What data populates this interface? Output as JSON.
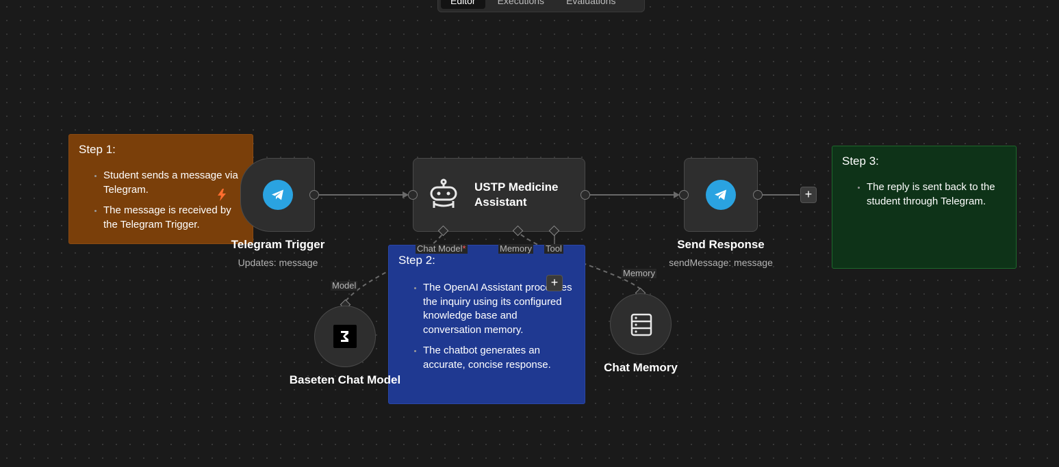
{
  "tabs": [
    {
      "label": "Editor",
      "active": true
    },
    {
      "label": "Executions",
      "active": false
    },
    {
      "label": "Evaluations",
      "active": false
    }
  ],
  "sticky_notes": {
    "step1": {
      "title": "Step 1:",
      "items": [
        "Student sends a message via Telegram.",
        "The message is received by the Telegram Trigger."
      ],
      "color": "#7a3f0a"
    },
    "step2": {
      "title": "Step 2:",
      "items": [
        "The OpenAI Assistant processes the inquiry using its configured knowledge base and conversation memory.",
        "The chatbot generates an accurate, concise response."
      ],
      "color": "#1f3991"
    },
    "step3": {
      "title": "Step 3:",
      "items": [
        "The reply is sent back to the student through Telegram."
      ],
      "color": "#0e3318"
    }
  },
  "nodes": {
    "telegram_trigger": {
      "label": "Telegram Trigger",
      "subtitle": "Updates: message",
      "icon": "telegram-icon"
    },
    "agent": {
      "label": "USTP Medicine Assistant",
      "icon": "robot-icon",
      "ports": {
        "chat_model": "Chat Model",
        "required_marker": "*",
        "memory": "Memory",
        "tool": "Tool"
      }
    },
    "send_response": {
      "label": "Send Response",
      "subtitle": "sendMessage: message",
      "icon": "telegram-icon"
    },
    "baseten": {
      "label": "Baseten Chat Model",
      "port": "Model",
      "icon": "baseten-icon"
    },
    "chat_memory": {
      "label": "Chat Memory",
      "port": "Memory",
      "icon": "database-icon"
    }
  },
  "colors": {
    "telegram": "#2aa3e1",
    "trigger_bolt": "#ff6d2e",
    "canvas": "#1a1a1a"
  }
}
